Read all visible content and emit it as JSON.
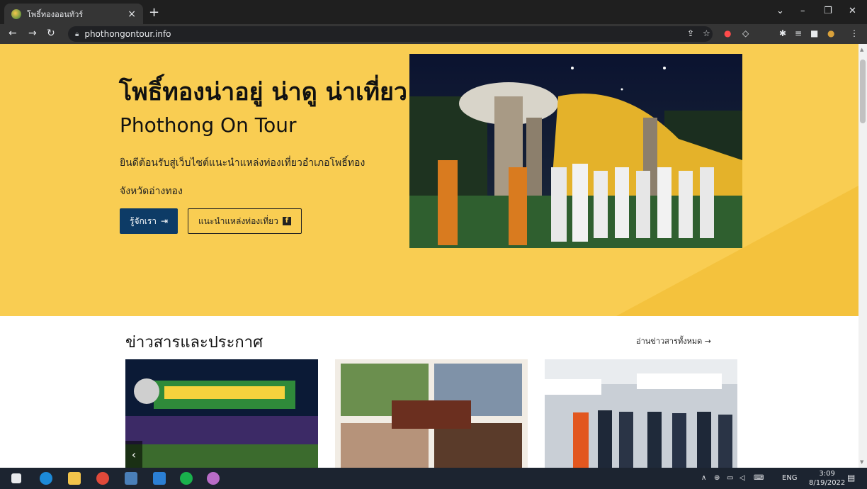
{
  "browser": {
    "tab_title": "โพธิ์ทองออนทัวร์",
    "tab_close": "×",
    "new_tab": "+",
    "url": "phothongontour.info"
  },
  "hero": {
    "title": "โพธิ์ทองน่าอยู่ น่าดู น่าเที่ยว",
    "subtitle": "Phothong On Tour",
    "desc_line1": "ยินดีต้อนรับสู่เว็บไซต์แนะนำแหล่งท่องเที่ยวอำเภอโพธิ์ทอง",
    "desc_line2": "จังหวัดอ่างทอง",
    "btn_about": "รู้จักเรา",
    "btn_about_icon": "⇥",
    "btn_travel": "แนะนำแหล่งท่องเที่ยว",
    "fb_glyph": "f"
  },
  "news": {
    "title": "ข่าวสารและประกาศ",
    "view_all": "อ่านข่าวสารทั้งหมด →"
  },
  "taskbar": {
    "lang": "ENG",
    "time": "3:09",
    "date": "8/19/2022"
  },
  "colors": {
    "hero_bg": "#f9cd52",
    "primary_btn": "#0d3b66"
  }
}
